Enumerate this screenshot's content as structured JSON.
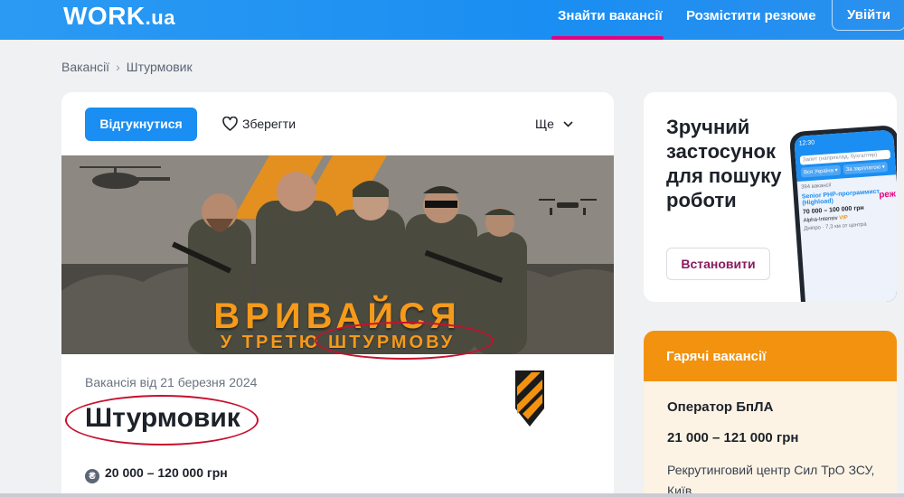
{
  "header": {
    "logo_main": "WORK",
    "logo_suffix": ".ua",
    "nav": [
      {
        "label": "Знайти вакансії"
      },
      {
        "label": "Розмістити резюме"
      }
    ],
    "login_label": "Увійти",
    "accent_color": "#1a8ef2",
    "active_underline_color": "#e6007e"
  },
  "breadcrumb": {
    "items": [
      "Вакансії",
      "Штурмовик"
    ],
    "separator": "›"
  },
  "job": {
    "apply_label": "Відгукнутися",
    "save_label": "Зберегти",
    "more_label": "Ще",
    "banner_text": "ВРИВАЙСЯ",
    "banner_subtext": "У ТРЕТЮ ШТУРМОВУ",
    "date_text": "Вакансія від 21 березня 2024",
    "title": "Штурмовик",
    "salary": "20 000 – 120 000 грн",
    "salary_icon": "hryvnia-coin-icon"
  },
  "app_promo": {
    "title": "Зручний застосунок для пошуку роботи",
    "install_label": "Встановити",
    "phone": {
      "time": "12:30",
      "search_placeholder": "Запит (наприклад, бухгалтер)",
      "filter_region": "Вся Україна ▾",
      "filter_salary": "За зарплатою ▾",
      "count": "394 вакансії",
      "job": "Senior PHP-программист (Highload)",
      "salary": "70 000 – 100 000 грн",
      "company": "Alpha-Intensiv",
      "vip": "VIP",
      "location": "Дніпро · 7,3 км от центра"
    }
  },
  "hot_jobs": {
    "heading": "Гарячі вакансії",
    "job_title": "Оператор БпЛА",
    "salary": "21 000 – 121 000 грн",
    "company": "Рекрутинговий центр Сил ТрО ЗСУ, Київ",
    "heading_color": "#f2920f"
  }
}
